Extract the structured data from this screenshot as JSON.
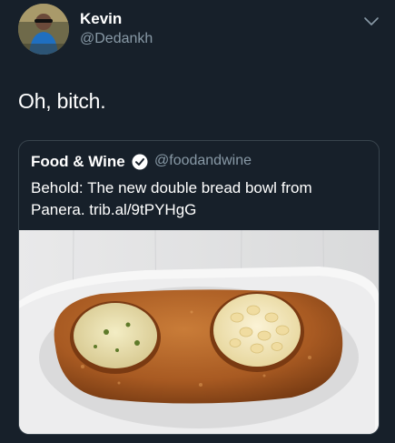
{
  "author": {
    "name": "Kevin",
    "handle": "@Dedankh",
    "avatar_icon": "avatar-photo"
  },
  "tweet": {
    "text": "Oh, bitch."
  },
  "quoted": {
    "name": "Food & Wine",
    "verified": true,
    "handle": "@foodandwine",
    "text": "Behold: The new double bread bowl from Panera. trib.al/9tPYHgG",
    "image_description_icon": "double-bread-bowl-photo"
  },
  "icons": {
    "menu": "chevron-down-icon",
    "verified": "verified-badge-icon"
  },
  "colors": {
    "background": "#17202a",
    "secondary_text": "#8899a6",
    "border": "#38444d"
  }
}
